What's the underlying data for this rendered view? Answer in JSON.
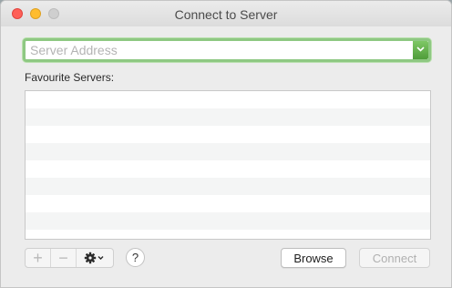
{
  "window": {
    "title": "Connect to Server"
  },
  "server": {
    "placeholder": "Server Address",
    "value": ""
  },
  "favourites": {
    "label": "Favourite Servers:",
    "rows": 8
  },
  "toolbar": {
    "add_symbol": "+",
    "remove_symbol": "−",
    "gear_icon": "gear-icon",
    "help_label": "?",
    "browse_label": "Browse",
    "connect_label": "Connect"
  },
  "colors": {
    "focus_ring": "#8ec882",
    "combo_button": "#5daa47",
    "close": "#fe5f57",
    "minimize": "#febc2e"
  }
}
